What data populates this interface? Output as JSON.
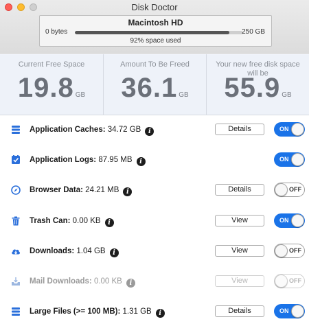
{
  "window": {
    "title": "Disk Doctor"
  },
  "disk": {
    "name": "Macintosh HD",
    "min_label": "0 bytes",
    "max_label": "250 GB",
    "used_text": "92% space used",
    "used_fraction": 0.92
  },
  "stats": [
    {
      "label": "Current Free Space",
      "value": "19.8",
      "unit": "GB"
    },
    {
      "label": "Amount To Be Freed",
      "value": "36.1",
      "unit": "GB"
    },
    {
      "label": "Your new free disk space will be",
      "value": "55.9",
      "unit": "GB"
    }
  ],
  "items": [
    {
      "name": "Application Caches:",
      "size": "34.72 GB",
      "button": "Details",
      "toggle": "ON",
      "icon": "stack-icon"
    },
    {
      "name": "Application Logs:",
      "size": "87.95 MB",
      "button": null,
      "toggle": "ON",
      "icon": "checklist-icon"
    },
    {
      "name": "Browser Data:",
      "size": "24.21 MB",
      "button": "Details",
      "toggle": "OFF",
      "icon": "compass-icon"
    },
    {
      "name": "Trash Can:",
      "size": "0.00 KB",
      "button": "View",
      "toggle": "ON",
      "icon": "trash-icon"
    },
    {
      "name": "Downloads:",
      "size": "1.04 GB",
      "button": "View",
      "toggle": "OFF",
      "icon": "cloud-download-icon"
    },
    {
      "name": "Mail Downloads:",
      "size": "0.00 KB",
      "button": "View",
      "toggle": "OFF",
      "icon": "mail-tray-icon",
      "disabled": true
    },
    {
      "name": "Large Files (>= 100 MB):",
      "size": "1.31 GB",
      "button": "Details",
      "toggle": "ON",
      "icon": "stack-icon"
    }
  ],
  "colors": {
    "accent": "#1a73e8",
    "icon": "#2a6fdb"
  }
}
